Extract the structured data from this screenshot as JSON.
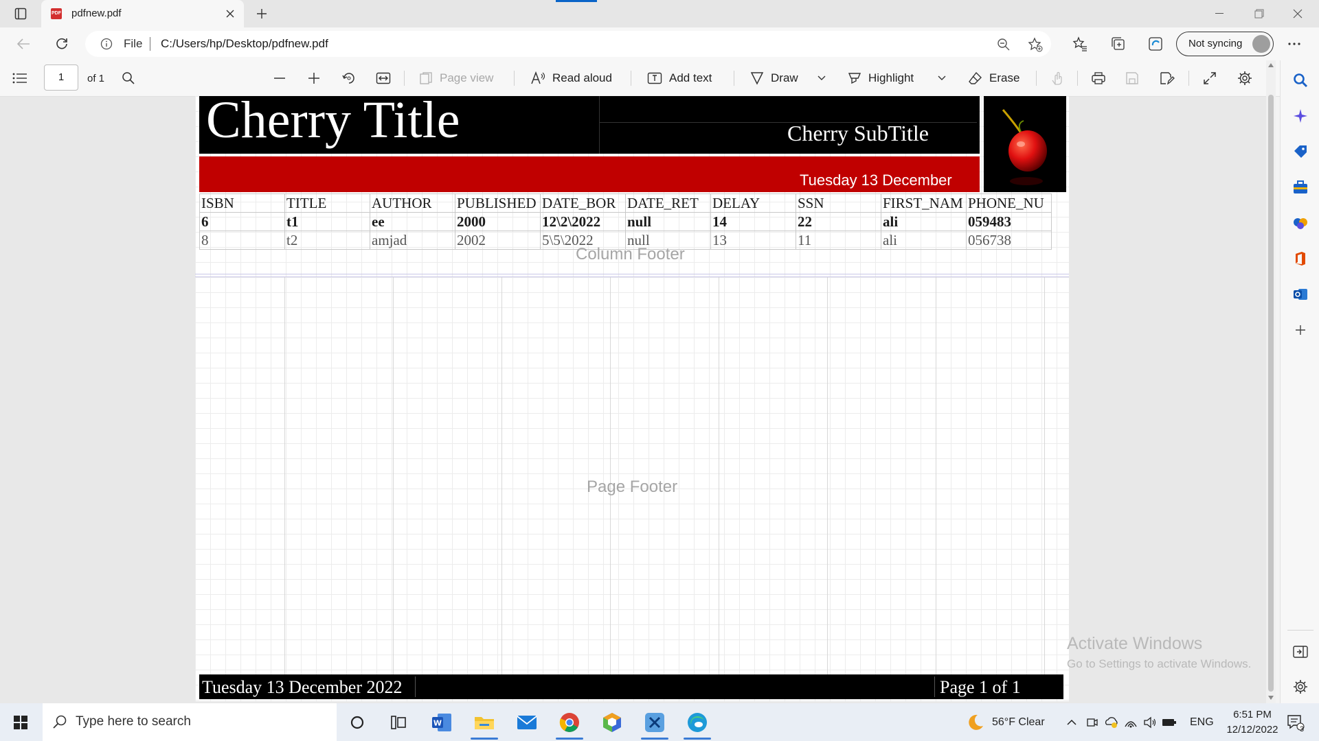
{
  "browser": {
    "tab_title": "pdfnew.pdf",
    "tab_icon_text": "PDF",
    "url_scheme": "File",
    "url": "C:/Users/hp/Desktop/pdfnew.pdf",
    "sync_label": "Not syncing"
  },
  "pdf_toolbar": {
    "page_current": "1",
    "page_total": "of 1",
    "page_view": "Page view",
    "read_aloud": "Read aloud",
    "add_text": "Add text",
    "draw": "Draw",
    "highlight": "Highlight",
    "erase": "Erase"
  },
  "document": {
    "title": "Cherry Title",
    "subtitle": "Cherry SubTitle",
    "date_short": "Tuesday 13 December",
    "table": {
      "header": [
        "ISBN",
        "TITLE",
        "AUTHOR",
        "PUBLISHED",
        "DATE_BOR",
        "DATE_RET",
        "DELAY",
        "SSN",
        "FIRST_NAM",
        "PHONE_NU"
      ],
      "rows": [
        [
          "6",
          "t1",
          "ee",
          "2000",
          "12\\2\\2022",
          "null",
          "14",
          "22",
          "ali",
          "059483"
        ],
        [
          "8",
          "t2",
          "amjad",
          "2002",
          "5\\5\\2022",
          "null",
          "13",
          "11",
          "ali",
          "056738"
        ]
      ]
    },
    "column_footer_label": "Column Footer",
    "page_footer_label": "Page Footer",
    "footer_date": "Tuesday 13 December 2022",
    "footer_page": "Page 1 of 1"
  },
  "watermark": {
    "line1": "Activate Windows",
    "line2": "Go to Settings to activate Windows."
  },
  "taskbar": {
    "search_placeholder": "Type here to search",
    "weather": "56°F  Clear",
    "language": "ENG",
    "time": "6:51 PM",
    "date": "12/12/2022",
    "notification_count": "3"
  },
  "colors": {
    "accent": "#0a64c8",
    "title_band": "#000000",
    "red_band": "#c00000"
  }
}
